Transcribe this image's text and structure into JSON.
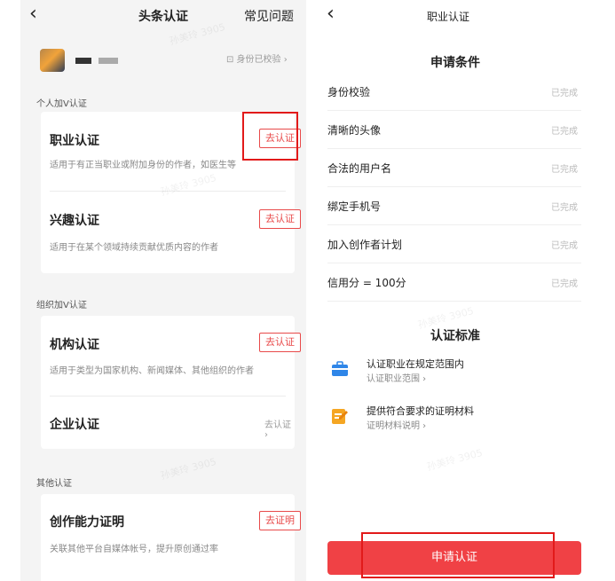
{
  "left_screen": {
    "nav": {
      "back_icon": "‹",
      "title": "头条认证",
      "faq": "常见问题"
    },
    "profile": {
      "id_status": "⊡ 身份已校验 ›"
    },
    "sections": [
      {
        "label": "个人加V认证",
        "items": [
          {
            "title": "职业认证",
            "desc": "适用于有正当职业或附加身份的作者，如医生等",
            "action": "去认证"
          },
          {
            "title": "兴趣认证",
            "desc": "适用于在某个领域持续贡献优质内容的作者",
            "action": "去认证"
          }
        ]
      },
      {
        "label": "组织加V认证",
        "items": [
          {
            "title": "机构认证",
            "desc": "适用于类型为国家机构、新闻媒体、其他组织的作者",
            "action": "去认证"
          },
          {
            "title": "企业认证",
            "desc": "",
            "action": "去认证 ›"
          }
        ]
      },
      {
        "label": "其他认证",
        "items": [
          {
            "title": "创作能力证明",
            "desc": "关联其他平台自媒体帐号，提升原创通过率",
            "action": "去证明"
          }
        ]
      }
    ]
  },
  "right_screen": {
    "nav": {
      "back_icon": "‹",
      "title": "职业认证"
    },
    "conditions_title": "申请条件",
    "conditions": [
      {
        "label": "身份校验",
        "status": "已完成"
      },
      {
        "label": "清晰的头像",
        "status": "已完成"
      },
      {
        "label": "合法的用户名",
        "status": "已完成"
      },
      {
        "label": "绑定手机号",
        "status": "已完成"
      },
      {
        "label": "加入创作者计划",
        "status": "已完成"
      },
      {
        "label": "信用分 = 100分",
        "status": "已完成"
      }
    ],
    "standards_title": "认证标准",
    "standards": [
      {
        "icon": "briefcase-icon",
        "title": "认证职业在规定范围内",
        "link": "认证职业范围 ›"
      },
      {
        "icon": "document-edit-icon",
        "title": "提供符合要求的证明材料",
        "link": "证明材料说明 ›"
      }
    ],
    "apply_button": "申请认证"
  },
  "watermark": "孙美玲 3905",
  "colors": {
    "accent": "#f04145",
    "highlight": "#e21a1a"
  }
}
